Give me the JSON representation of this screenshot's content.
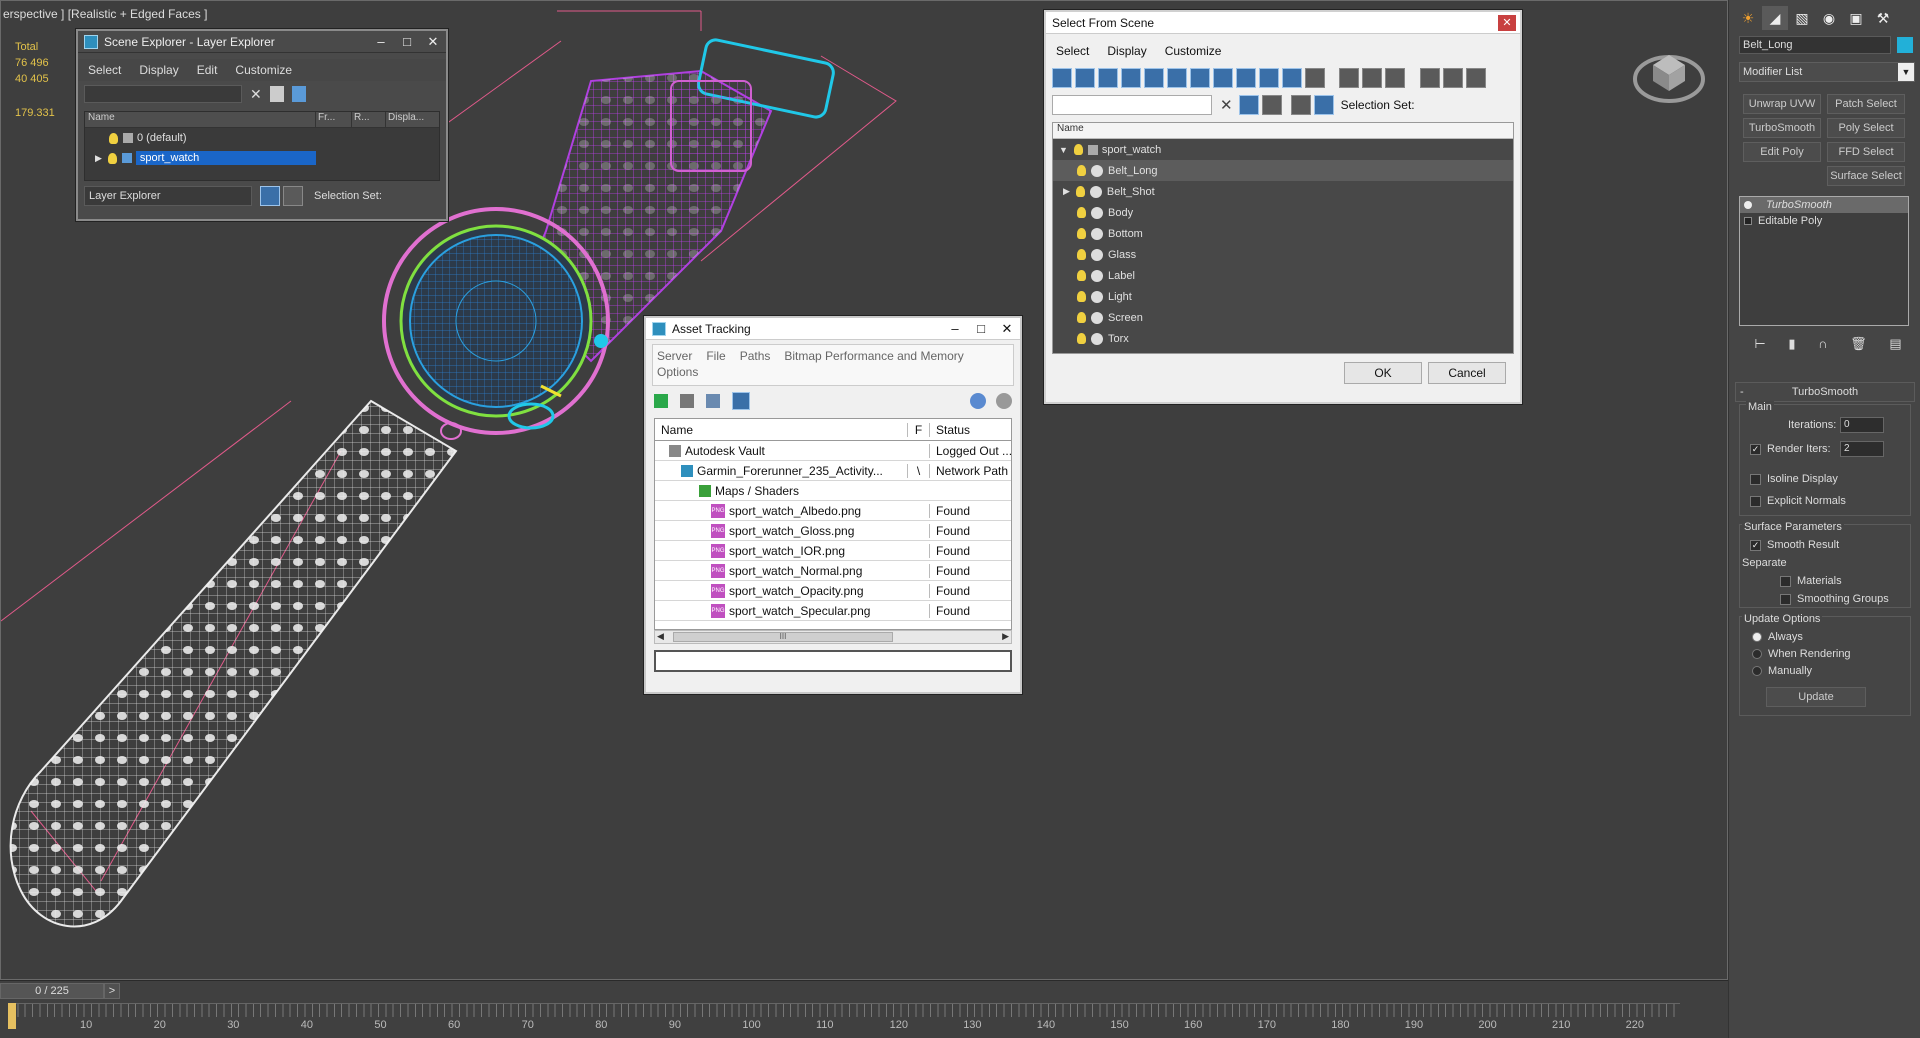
{
  "viewport": {
    "label": "erspective ] [Realistic + Edged Faces ]",
    "stats": {
      "total_label": "Total",
      "polys": "76 496",
      "verts": "40 405",
      "fps": "179.331"
    }
  },
  "scene_explorer": {
    "title": "Scene Explorer - Layer Explorer",
    "menu": [
      "Select",
      "Display",
      "Edit",
      "Customize"
    ],
    "columns": [
      "Name",
      "Fr...",
      "R...",
      "Displa..."
    ],
    "rows": [
      "0 (default)",
      "sport_watch"
    ],
    "footer_dropdown": "Layer Explorer",
    "selection_set_label": "Selection Set:"
  },
  "select_from_scene": {
    "title": "Select From Scene",
    "menu": [
      "Select",
      "Display",
      "Customize"
    ],
    "selection_set_label": "Selection Set:",
    "column_name": "Name",
    "root": "sport_watch",
    "items": [
      "Belt_Long",
      "Belt_Shot",
      "Body",
      "Bottom",
      "Glass",
      "Label",
      "Light",
      "Screen",
      "Torx"
    ],
    "ok_label": "OK",
    "cancel_label": "Cancel"
  },
  "asset_tracking": {
    "title": "Asset Tracking",
    "menu": [
      "Server",
      "File",
      "Paths",
      "Bitmap Performance and Memory"
    ],
    "menu2": "Options",
    "columns": {
      "name": "Name",
      "f": "F",
      "status": "Status"
    },
    "rows": [
      {
        "name": "Autodesk Vault",
        "f": "",
        "status": "Logged Out ..."
      },
      {
        "name": "Garmin_Forerunner_235_Activity...",
        "f": "\\",
        "status": "Network Path"
      },
      {
        "name": "Maps / Shaders",
        "f": "",
        "status": ""
      },
      {
        "name": "sport_watch_Albedo.png",
        "f": "",
        "status": "Found"
      },
      {
        "name": "sport_watch_Gloss.png",
        "f": "",
        "status": "Found"
      },
      {
        "name": "sport_watch_IOR.png",
        "f": "",
        "status": "Found"
      },
      {
        "name": "sport_watch_Normal.png",
        "f": "",
        "status": "Found"
      },
      {
        "name": "sport_watch_Opacity.png",
        "f": "",
        "status": "Found"
      },
      {
        "name": "sport_watch_Specular.png",
        "f": "",
        "status": "Found"
      }
    ],
    "png_badge": "PNG",
    "scroll_thumb": "III"
  },
  "command_panel": {
    "object_name": "Belt_Long",
    "object_color": "#22b0d8",
    "modifier_list": "Modifier List",
    "modifier_buttons": [
      "Unwrap UVW",
      "Patch Select",
      "TurboSmooth",
      "Poly Select",
      "Edit Poly",
      "FFD Select",
      "Surface Select"
    ],
    "stack": [
      "TurboSmooth",
      "Editable Poly"
    ],
    "turbosmooth": {
      "rollout_title": "TurboSmooth",
      "main_label": "Main",
      "iterations_label": "Iterations:",
      "iterations_value": "0",
      "render_iters_label": "Render Iters:",
      "render_iters_value": "2",
      "isoline_label": "Isoline Display",
      "explicit_normals_label": "Explicit Normals",
      "surface_params_label": "Surface Parameters",
      "smooth_result_label": "Smooth Result",
      "separate_label": "Separate",
      "materials_label": "Materials",
      "smoothing_groups_label": "Smoothing Groups",
      "update_options_label": "Update Options",
      "always_label": "Always",
      "when_rendering_label": "When Rendering",
      "manually_label": "Manually",
      "update_button": "Update"
    }
  },
  "timeline": {
    "frame_counter": "0 / 225",
    "next_arrow": ">",
    "ticks": [
      "10",
      "20",
      "30",
      "40",
      "50",
      "60",
      "70",
      "80",
      "90",
      "100",
      "110",
      "120",
      "130",
      "140",
      "150",
      "160",
      "170",
      "180",
      "190",
      "200",
      "210",
      "220"
    ]
  }
}
